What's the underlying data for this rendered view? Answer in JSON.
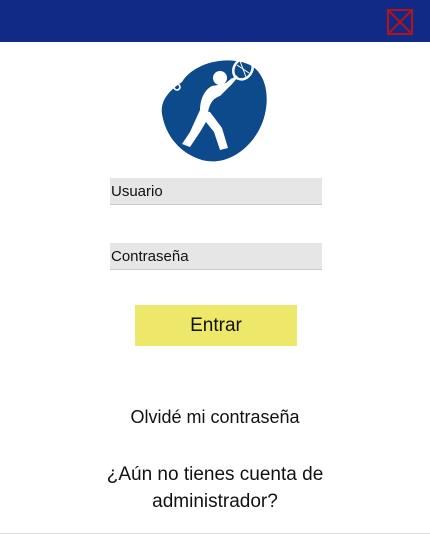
{
  "titlebar": {
    "color": "#112a85",
    "close_icon": "close-icon"
  },
  "logo": {
    "icon": "tennis-player-icon",
    "color": "#0d4a8c"
  },
  "login_form": {
    "username_placeholder": "Usuario",
    "password_placeholder": "Contraseña",
    "submit_label": "Entrar",
    "submit_color": "#eee86a"
  },
  "links": {
    "forgot_password": "Olvidé mi contraseña",
    "register": "¿Aún no tienes cuenta de administrador?"
  }
}
